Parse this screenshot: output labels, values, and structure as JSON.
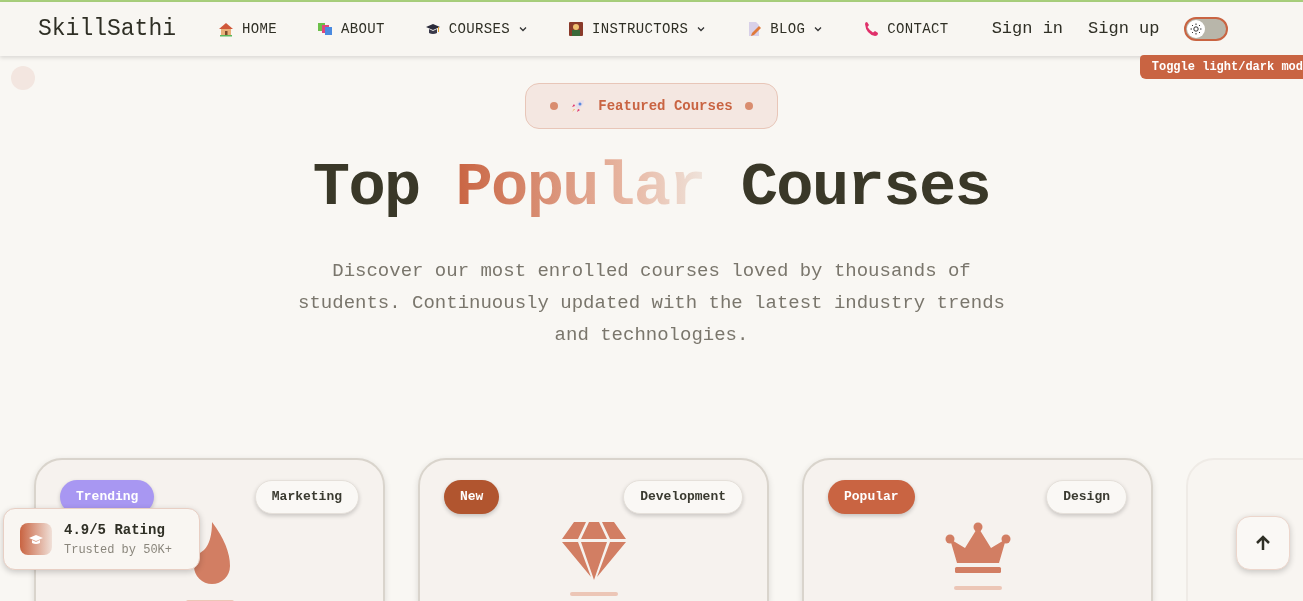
{
  "nav": {
    "brand": "SkillSathi",
    "links": [
      {
        "label": "HOME",
        "dropdown": false
      },
      {
        "label": "ABOUT",
        "dropdown": false
      },
      {
        "label": "COURSES",
        "dropdown": true
      },
      {
        "label": "INSTRUCTORS",
        "dropdown": true
      },
      {
        "label": "BLOG",
        "dropdown": true
      },
      {
        "label": "CONTACT",
        "dropdown": false
      }
    ],
    "auth": [
      "Sign in",
      "Sign up"
    ],
    "dark_mode": false,
    "tooltip": "Toggle light/dark mod"
  },
  "hero": {
    "badge": "Featured Courses",
    "title_start": "Top",
    "title_highlight": "Popular",
    "title_end": "Courses",
    "subtitle": "Discover our most enrolled courses loved by thousands of students. Continuously updated with the latest industry trends and technologies."
  },
  "cards": [
    {
      "badge": "Trending",
      "color": "#a897f2",
      "category": "Marketing"
    },
    {
      "badge": "New",
      "color": "#b1552f",
      "category": "Development"
    },
    {
      "badge": "Popular",
      "color": "#c96442",
      "category": "Design"
    }
  ],
  "rating": {
    "title": "4.9/5 Rating",
    "subtitle": "Trusted by 50K+"
  }
}
